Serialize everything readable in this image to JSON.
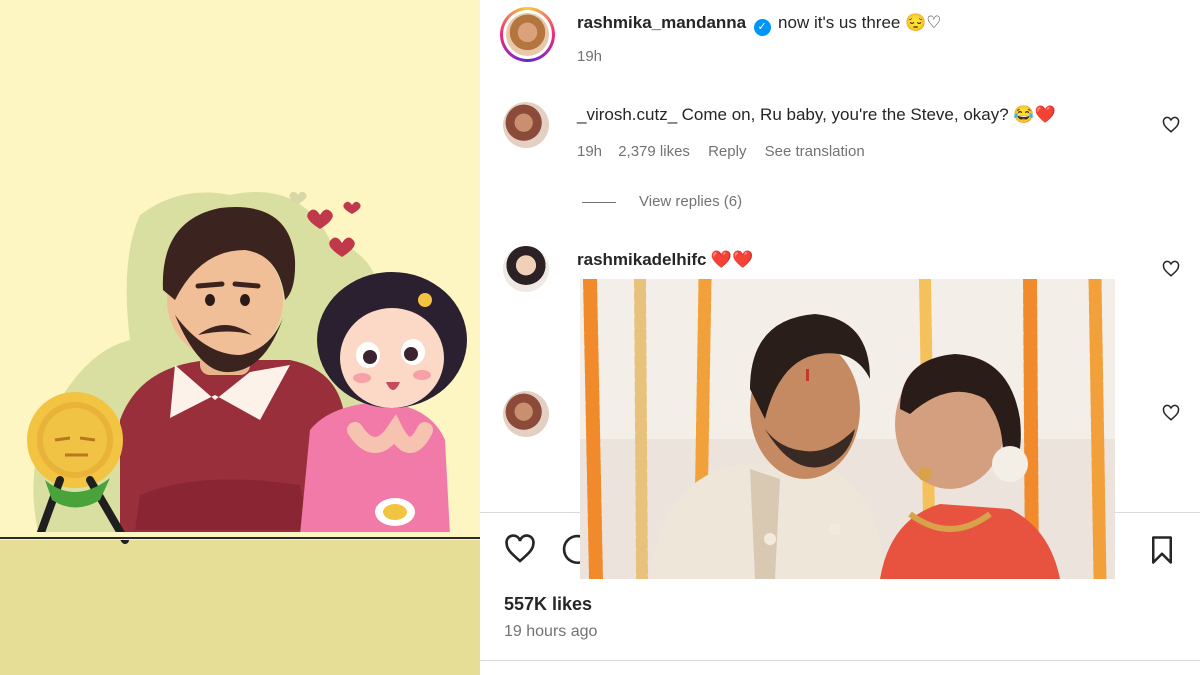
{
  "post": {
    "author": "rashmika_mandanna",
    "caption": "now it's us three 😔♡",
    "time": "19h"
  },
  "comments": [
    {
      "username": "_virosh.cutz_",
      "text": "Come on, Ru baby, you're the Steve, okay? 😂❤️",
      "time": "19h",
      "likes": "2,379 likes",
      "reply_label": "Reply",
      "translate_label": "See translation",
      "view_replies": "View replies (6)"
    },
    {
      "username": "rashmikadelhifc",
      "text": "❤️❤️"
    }
  ],
  "footer": {
    "likes": "557K likes",
    "time": "19 hours ago"
  },
  "icons": {
    "verified": "verified-badge-icon",
    "like": "heart-outline-icon",
    "comment": "comment-bubble-icon",
    "save": "bookmark-icon"
  },
  "colors": {
    "verified": "#0095f6",
    "illustration_bg": "#fdf5c2",
    "floor": "#e6dd96"
  }
}
